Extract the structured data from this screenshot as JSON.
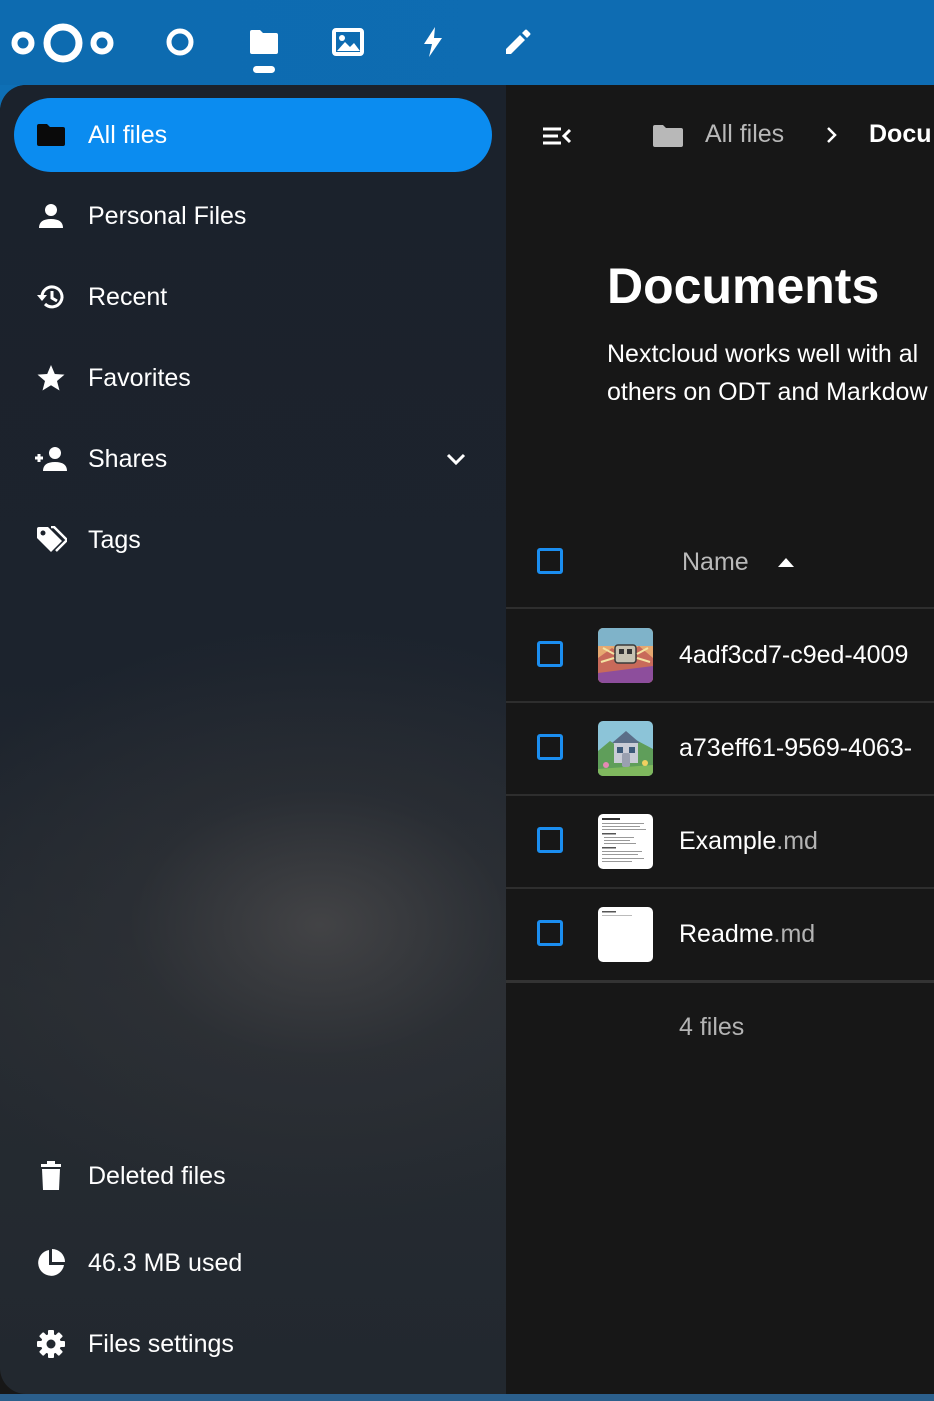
{
  "topbar": {
    "logo": "nextcloud-logo",
    "apps": [
      {
        "name": "dashboard",
        "icon": "circle-icon"
      },
      {
        "name": "files",
        "icon": "folder-icon",
        "active": true
      },
      {
        "name": "photos",
        "icon": "image-icon"
      },
      {
        "name": "activity",
        "icon": "lightning-icon"
      },
      {
        "name": "notes",
        "icon": "pencil-icon"
      }
    ]
  },
  "sidebar": {
    "items": [
      {
        "label": "All files",
        "icon": "folder-icon",
        "active": true
      },
      {
        "label": "Personal Files",
        "icon": "person-icon"
      },
      {
        "label": "Recent",
        "icon": "history-icon"
      },
      {
        "label": "Favorites",
        "icon": "star-icon"
      },
      {
        "label": "Shares",
        "icon": "share-person-icon",
        "expandable": true
      },
      {
        "label": "Tags",
        "icon": "tag-icon"
      }
    ],
    "footer": {
      "deleted": "Deleted files",
      "quota": "46.3 MB used",
      "settings": "Files settings"
    }
  },
  "breadcrumb": {
    "root": "All files",
    "current": "Docu"
  },
  "folder": {
    "title": "Documents",
    "description_line1": "Nextcloud works well with al",
    "description_line2": "others on ODT and Markdow"
  },
  "table": {
    "header_name": "Name",
    "sort": "ascending",
    "rows": [
      {
        "base": "4adf3cd7-c9ed-4009",
        "ext": "",
        "thumb": "robot-art"
      },
      {
        "base": "a73eff61-9569-4063-",
        "ext": "",
        "thumb": "house-art"
      },
      {
        "base": "Example",
        "ext": ".md",
        "thumb": "document-page"
      },
      {
        "base": "Readme",
        "ext": ".md",
        "thumb": "blank-page"
      }
    ],
    "summary": "4 files"
  },
  "colors": {
    "topbar": "#0e6cb3",
    "accent": "#0b8cf0",
    "background": "#171717"
  }
}
